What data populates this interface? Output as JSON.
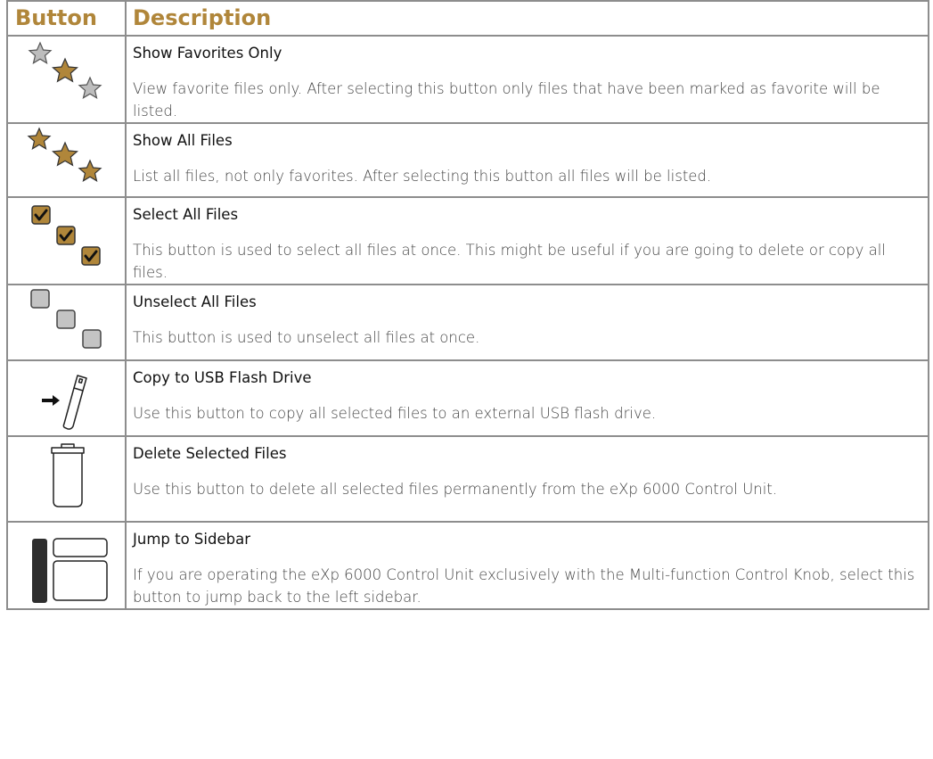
{
  "table": {
    "header": {
      "col1": "Button",
      "col2": "Description"
    },
    "rows": [
      {
        "icon": "stars-outline-icon",
        "title": "Show Favorites Only",
        "text": "View favorite files only. After selecting this button only files that have been marked as favorite will be listed."
      },
      {
        "icon": "stars-filled-icon",
        "title": "Show All Files",
        "text": "List all files, not only favorites. After selecting this button all files will be listed."
      },
      {
        "icon": "checkboxes-checked-icon",
        "title": "Select All Files",
        "text": "This button is used to select all files at once. This might be useful if you are going to delete or copy all files."
      },
      {
        "icon": "checkboxes-empty-icon",
        "title": "Unselect All Files",
        "text": "This button is used to unselect all files at once."
      },
      {
        "icon": "usb-copy-icon",
        "title": "Copy to USB Flash Drive",
        "text": "Use this button to copy all selected files to an external USB flash drive."
      },
      {
        "icon": "trash-icon",
        "title": "Delete Selected Files",
        "text": "Use this button to delete all selected files permanently from the eXp 6000 Control Unit."
      },
      {
        "icon": "sidebar-icon",
        "title": "Jump to Sidebar",
        "text": "If you are operating the eXp 6000 Control Unit exclusively with the Multi-function Control Knob, select this button to jump back to the left sidebar."
      }
    ]
  },
  "colors": {
    "gold": "#b0863a",
    "grey": "#b8b8b8",
    "border": "#8d8d8d"
  }
}
